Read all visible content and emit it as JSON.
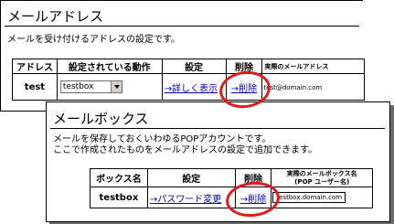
{
  "address_panel": {
    "title": "メールアドレス",
    "description": "メールを受け付けるアドレスの設定です。",
    "table": {
      "headers": {
        "address": "アドレス",
        "action": "設定されている動作",
        "settings": "設定",
        "delete": "削除",
        "real_address": "実際のメールアドレス"
      },
      "row": {
        "address": "test",
        "action_selected": "testbox",
        "settings_link": "→詳しく表示",
        "delete_link": "→削除",
        "real_address": "test@domain.com"
      }
    }
  },
  "mailbox_panel": {
    "title": "メールボックス",
    "description_line1": "メールを保存しておくいわゆるPOPアカウントです。",
    "description_line2": "ここで作成されたものをメールアドレスの設定で追加できます。",
    "table": {
      "headers": {
        "mailbox_name": "ボックス名",
        "settings": "設定",
        "delete": "削除",
        "real_mailbox_name_line1": "実際のメールボックス名",
        "real_mailbox_name_line2": "(POP ユーザー名)"
      },
      "row": {
        "mailbox_name": "testbox",
        "settings_link": "→パスワード変更",
        "delete_link": "→削除",
        "real_mailbox_name": "testbox.domain.com"
      }
    }
  },
  "colors": {
    "highlight": "#e11b1b",
    "link": "#0000cc"
  }
}
